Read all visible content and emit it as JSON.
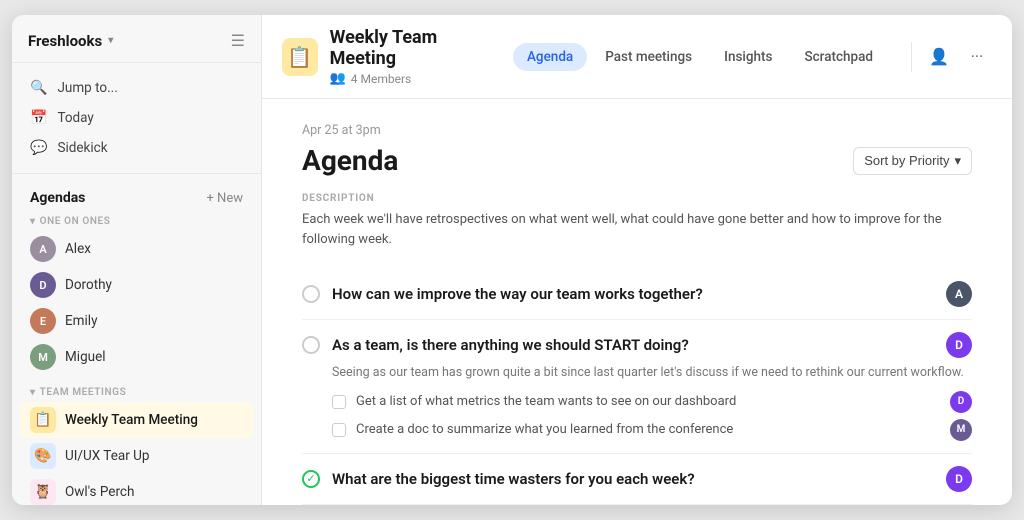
{
  "sidebar": {
    "brand": "Freshlooks",
    "nav_items": [
      {
        "id": "jump",
        "label": "Jump to...",
        "icon": "🔍"
      },
      {
        "id": "today",
        "label": "Today",
        "icon": "📅"
      },
      {
        "id": "sidekick",
        "label": "Sidekick",
        "icon": "💬"
      }
    ],
    "agendas_title": "Agendas",
    "new_btn": "+ New",
    "one_on_ones_label": "ONE ON ONES",
    "persons": [
      {
        "name": "Alex",
        "color": "#9b8ea0"
      },
      {
        "name": "Dorothy",
        "color": "#6b5b95"
      },
      {
        "name": "Emily",
        "color": "#c47a5a"
      },
      {
        "name": "Miguel",
        "color": "#7a9e7e"
      }
    ],
    "team_meetings_label": "TEAM MEETINGS",
    "meetings": [
      {
        "id": "weekly",
        "label": "Weekly Team Meeting",
        "emoji": "📋",
        "emoji_bg": "#fde9a2",
        "active": true
      },
      {
        "id": "uiux",
        "label": "UI/UX Tear Up",
        "emoji": "🎨",
        "emoji_bg": "#dbeafe"
      },
      {
        "id": "owls",
        "label": "Owl's Perch",
        "emoji": "🦉",
        "emoji_bg": "#fce7f3"
      }
    ]
  },
  "header": {
    "meeting_emoji": "📋",
    "meeting_emoji_bg": "#fde9a2",
    "title": "Weekly Team Meeting",
    "members_count": "4 Members",
    "tabs": [
      {
        "id": "agenda",
        "label": "Agenda",
        "active": true
      },
      {
        "id": "past",
        "label": "Past meetings"
      },
      {
        "id": "insights",
        "label": "Insights"
      },
      {
        "id": "scratchpad",
        "label": "Scratchpad"
      }
    ]
  },
  "content": {
    "date": "Apr 25 at 3pm",
    "title": "Agenda",
    "sort_label": "Sort by Priority",
    "description_label": "DESCRIPTION",
    "description_text": "Each week we'll have retrospectives on what went well, what could have gone better and how to improve for the following week.",
    "agenda_items": [
      {
        "id": "item1",
        "title": "How can we improve the way our team works together?",
        "checked": false,
        "completed": false,
        "avatar_color": "#4a5568",
        "avatar_initials": "A",
        "sub_description": null,
        "sub_tasks": []
      },
      {
        "id": "item2",
        "title": "As a team, is there anything we should START doing?",
        "checked": false,
        "completed": false,
        "avatar_color": "#7c3aed",
        "avatar_initials": "D",
        "sub_description": "Seeing as our team has grown quite a bit since last quarter let's discuss if we need to rethink our current workflow.",
        "sub_tasks": [
          {
            "text": "Get a list of what metrics the team wants to see on our dashboard",
            "avatar_color": "#7c3aed",
            "avatar_initials": "D"
          },
          {
            "text": "Create a doc to summarize what you learned from the conference",
            "avatar_color": "#6b5b95",
            "avatar_initials": "M"
          }
        ]
      },
      {
        "id": "item3",
        "title": "What are the biggest time wasters for you each week?",
        "checked": true,
        "completed": false,
        "avatar_color": "#7c3aed",
        "avatar_initials": "D",
        "sub_description": null,
        "sub_tasks": []
      }
    ]
  }
}
